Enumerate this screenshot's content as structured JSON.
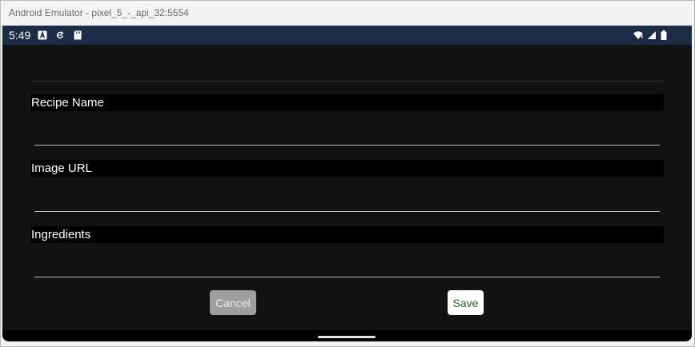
{
  "window": {
    "title": "Android Emulator - pixel_5_-_api_32:5554"
  },
  "status_bar": {
    "time": "5:49",
    "left_icons": [
      "a-notification-icon",
      "sync-notification-icon",
      "sd-card-icon"
    ],
    "right_icons": [
      "wifi-icon",
      "signal-icon",
      "battery-icon"
    ]
  },
  "form": {
    "fields": [
      {
        "label": "Recipe Name",
        "value": ""
      },
      {
        "label": "Image URL",
        "value": ""
      },
      {
        "label": "Ingredients",
        "value": ""
      }
    ],
    "cancel_label": "Cancel",
    "save_label": "Save"
  },
  "colors": {
    "status_bar": "#1c2c46",
    "background": "#121212",
    "cancel_button": "#9e9e9e",
    "save_text": "#1f6b1f"
  }
}
